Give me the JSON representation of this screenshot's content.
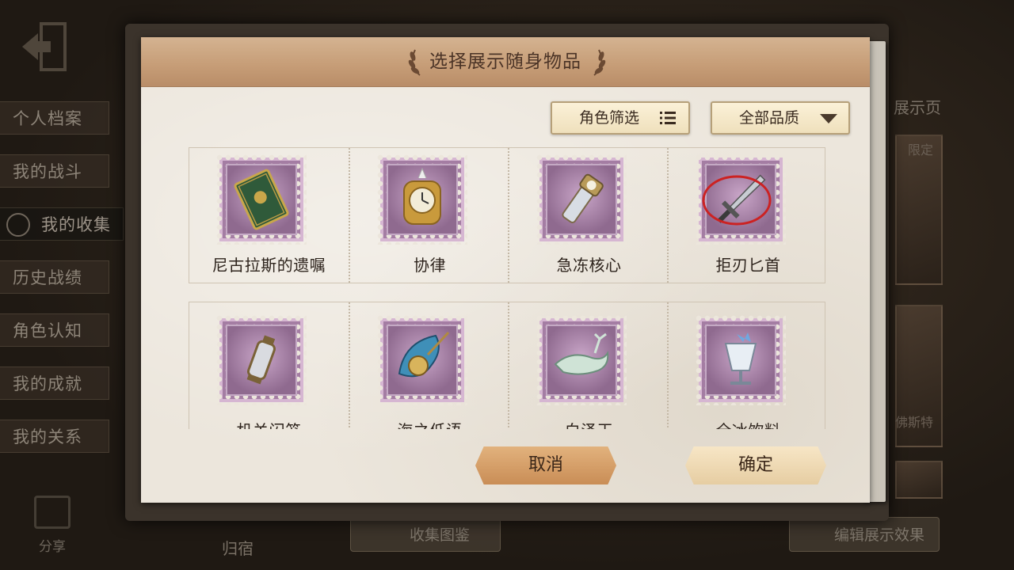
{
  "background": {
    "side_menu": [
      {
        "label": "个人档案"
      },
      {
        "label": "我的战斗"
      },
      {
        "label": "我的收集",
        "active": true
      },
      {
        "label": "历史战绩"
      },
      {
        "label": "角色认知"
      },
      {
        "label": "我的成就"
      },
      {
        "label": "我的关系"
      }
    ],
    "share_label": "分享",
    "home_label": "归宿",
    "collection_guide_label": "收集图鉴",
    "edit_display_label": "编辑展示效果",
    "right_title": "展示页",
    "right_tag_limited": "限定",
    "right_tag_name": "佛斯特"
  },
  "dialog": {
    "title": "选择展示随身物品",
    "role_filter_label": "角色筛选",
    "quality_filter_label": "全部品质",
    "items": [
      {
        "name": "尼古拉斯的遗嘱",
        "icon": "green-book-icon"
      },
      {
        "name": "协律",
        "icon": "golden-clock-icon"
      },
      {
        "name": "急冻核心",
        "icon": "flashlight-icon"
      },
      {
        "name": "拒刃匕首",
        "icon": "dagger-icon"
      },
      {
        "name": "机关闪笼",
        "icon": "lantern-icon"
      },
      {
        "name": "海之低语",
        "icon": "sea-horn-icon"
      },
      {
        "name": "白泽玉",
        "icon": "jade-beast-icon"
      },
      {
        "name": "全冰饮料",
        "icon": "ice-drink-icon"
      }
    ],
    "cancel_label": "取消",
    "confirm_label": "确定"
  },
  "colors": {
    "header": "#c79e78",
    "paper": "#ece6dc",
    "stamp": "#a47da3",
    "cancel": "#d9a06a",
    "confirm": "#f0dcb6"
  }
}
